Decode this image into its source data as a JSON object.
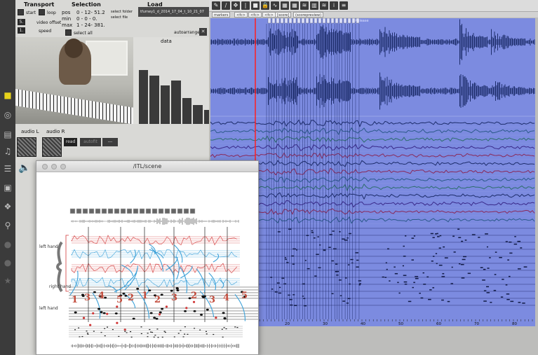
{
  "dock": {
    "icons": [
      "cube-icon",
      "target-icon",
      "film-icon",
      "music-note-icon",
      "playlist-icon",
      "image-icon",
      "link-icon",
      "plug-icon",
      "circle-p-icon",
      "circle-b-icon",
      "star-icon"
    ],
    "accent": "#e7d21b"
  },
  "transport": {
    "title": "Transport",
    "start_label": "start",
    "loop_label": "loop",
    "video_offset_value": "5.",
    "video_offset_label": "video offset",
    "speed_value": "1.",
    "speed_label": "speed"
  },
  "selection": {
    "title": "Selection",
    "pos_label": "pos",
    "pos_value": "0 - 12- 51.2",
    "min_label": "min",
    "min_value": "0 - 0 - 0.",
    "max_label": "max",
    "max_value": "1 - 24- 381.",
    "select_all_label": "select all"
  },
  "load": {
    "title": "Load",
    "select_folder_label": "select folder",
    "select_file_label": "select file",
    "file_value": "tfurney1_d_2014_17_04_t_10_21_07",
    "autoarrange_label": "autoarrange",
    "close_label": "✕"
  },
  "data_panel": {
    "label": "data",
    "levels": [
      0.62,
      0.56,
      0.44,
      0.5,
      0.3,
      0.22,
      0.16
    ]
  },
  "audio": {
    "left_label": "audio L",
    "right_label": "audio R",
    "read_label": "read",
    "autofit_label": "autofit",
    "dash_label": "---"
  },
  "wave_window": {
    "toolbar_icons": [
      "pencil-icon",
      "pen-icon",
      "move-icon",
      "marker-icon",
      "square-icon",
      "lock-icon",
      "wave-icon",
      "grid-icon",
      "grid2-icon",
      "waveform-icon",
      "bars-icon",
      "waveform2-icon",
      "info-icon",
      "list-icon"
    ],
    "tabs": [
      "markers",
      "<fc>",
      "<fc>",
      "<fc>",
      "[score]",
      "(scorepreview)"
    ],
    "marker_text": "Release",
    "ruler_ticks": [
      "20",
      "30",
      "40",
      "50",
      "60",
      "70",
      "80"
    ],
    "colors": {
      "background": "#7c8be0",
      "wave": "#1d2d6b",
      "playhead": "#ff2020",
      "selection": "#1c2a6a"
    }
  },
  "scene": {
    "title": "/ITL/scene",
    "labels": {
      "left_hand_top": "left hand",
      "right_hand": "right hand",
      "left_hand_bottom": "left hand"
    },
    "fingering": [
      "1",
      "3",
      "4",
      "5",
      "2",
      "1",
      "2",
      "3",
      "2",
      "3",
      "4",
      "5"
    ],
    "colors": {
      "blue": "#3aa0d8",
      "red": "#d23a3a",
      "finger": "#c24a3a"
    }
  }
}
